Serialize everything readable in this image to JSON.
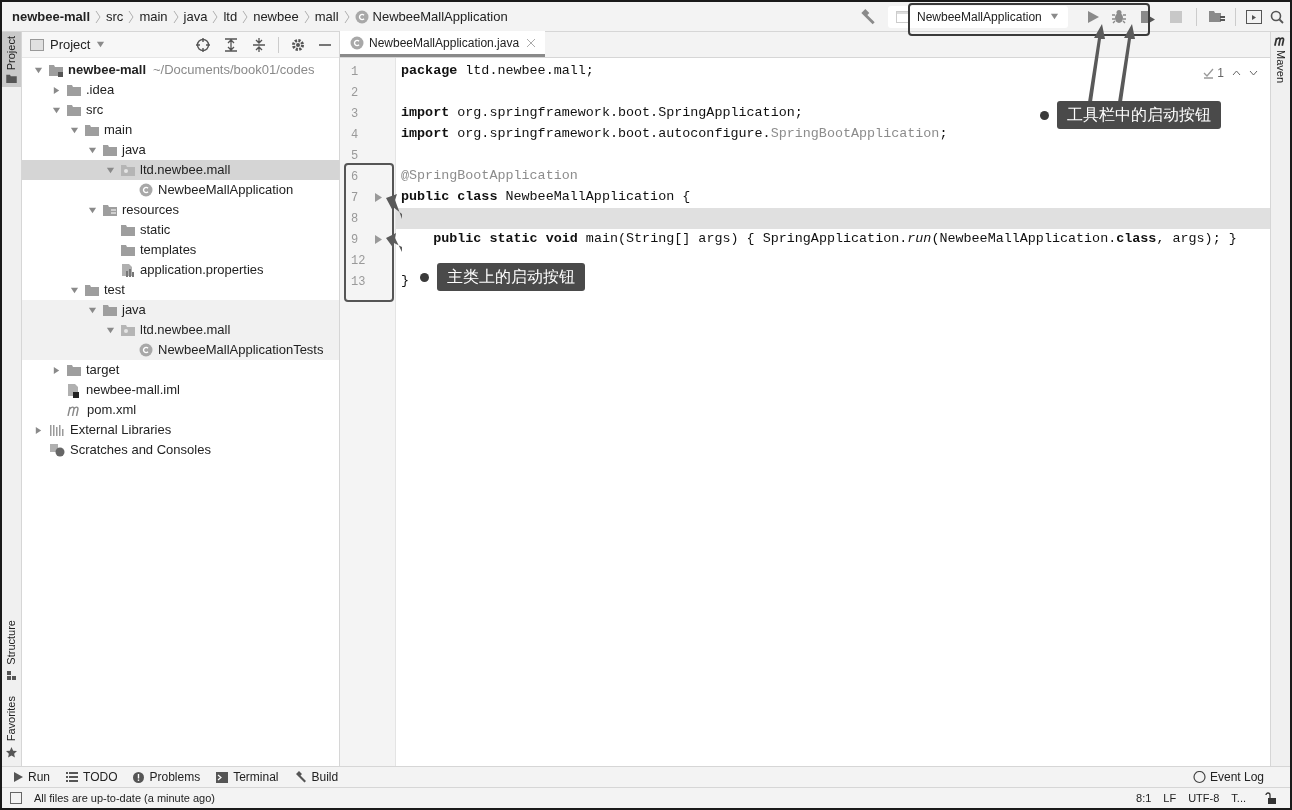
{
  "breadcrumbs": [
    {
      "label": "newbee-mall",
      "kind": "project"
    },
    {
      "label": "src",
      "kind": "folder"
    },
    {
      "label": "main",
      "kind": "folder"
    },
    {
      "label": "java",
      "kind": "folder"
    },
    {
      "label": "ltd",
      "kind": "folder"
    },
    {
      "label": "newbee",
      "kind": "folder"
    },
    {
      "label": "mall",
      "kind": "folder"
    },
    {
      "label": "NewbeeMallApplication",
      "kind": "class"
    }
  ],
  "run_config": {
    "label": "NewbeeMallApplication"
  },
  "left_strip": [
    {
      "label": "Project",
      "selected": true,
      "kind": "top"
    },
    {
      "label": "Structure",
      "selected": false,
      "kind": "bottom"
    },
    {
      "label": "Favorites",
      "selected": false,
      "kind": "bottom"
    }
  ],
  "right_strip": [
    {
      "label": "Maven"
    }
  ],
  "project_panel": {
    "title": "Project",
    "tree": [
      {
        "label": "newbee-mall",
        "path": "~/Documents/book01/codes",
        "kind": "module",
        "bold": true,
        "expanded": true,
        "selected": false,
        "shaded": false,
        "children": [
          {
            "label": ".idea",
            "kind": "folder",
            "expanded": false,
            "selected": false,
            "shaded": false
          },
          {
            "label": "src",
            "kind": "folder",
            "expanded": true,
            "selected": false,
            "shaded": false,
            "children": [
              {
                "label": "main",
                "kind": "folder",
                "expanded": true,
                "selected": false,
                "shaded": false,
                "children": [
                  {
                    "label": "java",
                    "kind": "folder",
                    "expanded": true,
                    "selected": false,
                    "shaded": false,
                    "children": [
                      {
                        "label": "ltd.newbee.mall",
                        "kind": "package",
                        "expanded": true,
                        "selected": true,
                        "shaded": false,
                        "children": [
                          {
                            "label": "NewbeeMallApplication",
                            "kind": "class",
                            "selected": false,
                            "shaded": false
                          }
                        ]
                      }
                    ]
                  },
                  {
                    "label": "resources",
                    "kind": "resources",
                    "expanded": true,
                    "selected": false,
                    "shaded": false,
                    "children": [
                      {
                        "label": "static",
                        "kind": "folder",
                        "selected": false,
                        "shaded": false
                      },
                      {
                        "label": "templates",
                        "kind": "folder",
                        "selected": false,
                        "shaded": false
                      },
                      {
                        "label": "application.properties",
                        "kind": "properties",
                        "selected": false,
                        "shaded": false
                      }
                    ]
                  }
                ]
              },
              {
                "label": "test",
                "kind": "folder",
                "expanded": true,
                "selected": false,
                "shaded": false,
                "children": [
                  {
                    "label": "java",
                    "kind": "folder",
                    "expanded": true,
                    "selected": false,
                    "shaded": true,
                    "children": [
                      {
                        "label": "ltd.newbee.mall",
                        "kind": "package",
                        "expanded": true,
                        "selected": false,
                        "shaded": true,
                        "children": [
                          {
                            "label": "NewbeeMallApplicationTests",
                            "kind": "class",
                            "selected": false,
                            "shaded": true
                          }
                        ]
                      }
                    ]
                  }
                ]
              }
            ]
          },
          {
            "label": "target",
            "kind": "folder",
            "expanded": false,
            "selected": false,
            "shaded": false
          },
          {
            "label": "newbee-mall.iml",
            "kind": "iml",
            "selected": false,
            "shaded": false
          },
          {
            "label": "pom.xml",
            "kind": "maven",
            "selected": false,
            "shaded": false
          }
        ]
      },
      {
        "label": "External Libraries",
        "kind": "libraries",
        "expanded": false,
        "selected": false,
        "shaded": false
      },
      {
        "label": "Scratches and Consoles",
        "kind": "scratches",
        "selected": false,
        "shaded": false
      }
    ]
  },
  "editor": {
    "tabs": [
      {
        "label": "NewbeeMallApplication.java",
        "selected": true
      }
    ],
    "problems": "1",
    "lines": [
      {
        "number": "1",
        "run": false,
        "current": false,
        "segments": [
          {
            "kind": "code",
            "text": "**package** ltd.newbee.mall;"
          }
        ]
      },
      {
        "number": "2",
        "run": false,
        "current": false
      },
      {
        "number": "3",
        "run": false,
        "current": false,
        "segments": [
          {
            "kind": "code",
            "text": "**import** org.springframework.boot.SpringApplication;"
          }
        ]
      },
      {
        "number": "4",
        "run": false,
        "current": false,
        "segments": [
          {
            "kind": "code",
            "text": "**import** org.springframework.boot.autoconfigure."
          },
          {
            "kind": "unresolved",
            "text": "SpringBootApplication"
          },
          {
            "kind": "code",
            "text": ";"
          }
        ]
      },
      {
        "number": "5",
        "run": false,
        "current": false
      },
      {
        "number": "6",
        "run": false,
        "current": false,
        "segments": [
          {
            "kind": "unresolved",
            "text": "@SpringBootApplication"
          }
        ]
      },
      {
        "number": "7",
        "run": true,
        "current": false,
        "segments": [
          {
            "kind": "code",
            "text": "**public class** NewbeeMallApplication {"
          }
        ]
      },
      {
        "number": "8",
        "run": false,
        "current": true
      },
      {
        "number": "9",
        "run": true,
        "current": false,
        "segments": [
          {
            "kind": "code",
            "text": "    **public static void** main(String[] args) { SpringApplication.*run*(NewbeeMallApplication.**class**, args); }"
          }
        ]
      },
      {
        "number": "12",
        "run": false,
        "current": false
      },
      {
        "number": "13",
        "run": false,
        "current": false,
        "segments": [
          {
            "kind": "code",
            "text": "}"
          }
        ]
      }
    ]
  },
  "callouts": [
    {
      "text": "工具栏中的启动按钮"
    },
    {
      "text": "主类上的启动按钮"
    }
  ],
  "bottom_tools": [
    {
      "label": "Run",
      "kind": "run"
    },
    {
      "label": "TODO",
      "kind": "list"
    },
    {
      "label": "Problems",
      "kind": "problems"
    },
    {
      "label": "Terminal",
      "kind": "terminal"
    },
    {
      "label": "Build",
      "kind": "hammer"
    }
  ],
  "event_log": "Event Log",
  "status_bar": {
    "message": "All files are up-to-date (a minute ago)",
    "items": [
      "8:1",
      "LF",
      "UTF-8",
      "T..."
    ]
  }
}
